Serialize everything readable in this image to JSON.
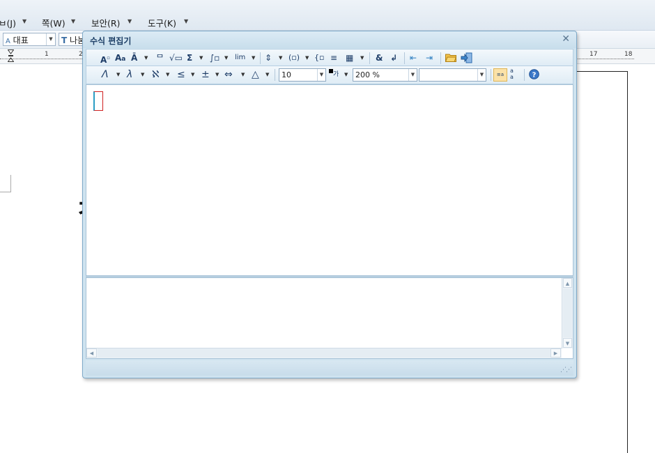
{
  "host_app": {
    "menubar": {
      "items": [
        {
          "label": "입력(J)",
          "visible": "ㅂ(J)"
        },
        {
          "label": "쪽(W)"
        },
        {
          "label": "보안(R)"
        },
        {
          "label": "도구(K)"
        }
      ]
    },
    "toolbar": {
      "style_combo": "대표",
      "font_combo": "나눔"
    },
    "ruler": {
      "labels": [
        "1",
        "2",
        "17",
        "18"
      ]
    },
    "document": {
      "glyph": "ㅊ"
    }
  },
  "equation_editor": {
    "title": "수식 편집기",
    "toolbar1": {
      "icons": [
        {
          "name": "superscript-icon",
          "glyph": "A²"
        },
        {
          "name": "font-size-icon",
          "glyph": "Aa"
        },
        {
          "name": "accent-icon",
          "glyph": "Ā"
        },
        {
          "name": "fraction-icon",
          "glyph": "ᄆ"
        },
        {
          "name": "root-icon",
          "glyph": "√□"
        },
        {
          "name": "sum-icon",
          "glyph": "Σ"
        },
        {
          "name": "integral-icon",
          "glyph": "∫□"
        },
        {
          "name": "limit-icon",
          "glyph": "lim"
        },
        {
          "name": "arrow-stack-icon",
          "glyph": "⇔"
        },
        {
          "name": "bracket-icon",
          "glyph": "(□)"
        },
        {
          "name": "case-icon",
          "glyph": "{□"
        },
        {
          "name": "matrix-row-icon",
          "glyph": "≡"
        },
        {
          "name": "matrix-icon",
          "glyph": "▦"
        },
        {
          "name": "ampersand-icon",
          "glyph": "&"
        },
        {
          "name": "newline-icon",
          "glyph": "↲"
        },
        {
          "name": "previous-icon",
          "glyph": "⇤"
        },
        {
          "name": "next-icon",
          "glyph": "⇥"
        },
        {
          "name": "open-file-icon",
          "glyph": "📂"
        },
        {
          "name": "insert-icon",
          "glyph": "⇒"
        }
      ]
    },
    "toolbar2": {
      "icons": [
        {
          "name": "greek-upper-icon",
          "glyph": "Λ"
        },
        {
          "name": "greek-lower-icon",
          "glyph": "λ"
        },
        {
          "name": "hebrew-icon",
          "glyph": "ℵ"
        },
        {
          "name": "relation-icon",
          "glyph": "≤"
        },
        {
          "name": "operator-icon",
          "glyph": "±"
        },
        {
          "name": "arrow-icon",
          "glyph": "⇔"
        },
        {
          "name": "misc-symbol-icon",
          "glyph": "△"
        },
        {
          "name": "text-color-icon",
          "glyph": "■가"
        },
        {
          "name": "display-mode-icon",
          "glyph": "≡a"
        },
        {
          "name": "script-mode-icon",
          "glyph": "a/a"
        },
        {
          "name": "help-icon",
          "glyph": "?"
        }
      ],
      "font_size": "10",
      "zoom": "200 %",
      "font_name": ""
    },
    "colors": {
      "window_bg": "#cfe3ef",
      "title_text": "#1d3f66",
      "cursor": "#d02020"
    }
  }
}
